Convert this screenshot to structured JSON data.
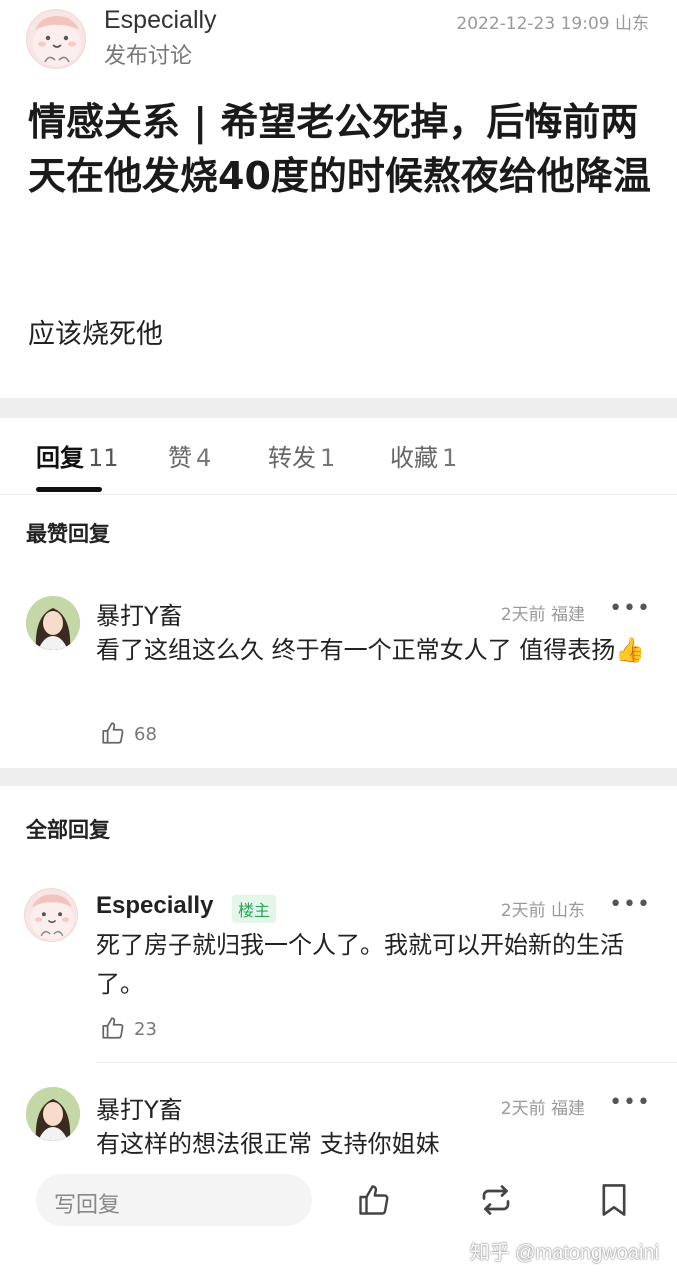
{
  "post": {
    "author": "Especially",
    "action": "发布讨论",
    "time": "2022-12-23 19:09 山东",
    "title": "情感关系 | 希望老公死掉，后悔前两天在他发烧40度的时候熬夜给他降温",
    "body": "应该烧死他"
  },
  "tabs": [
    {
      "label": "回复",
      "count": "11"
    },
    {
      "label": "赞",
      "count": "4"
    },
    {
      "label": "转发",
      "count": "1"
    },
    {
      "label": "收藏",
      "count": "1"
    }
  ],
  "sections": {
    "top_replies": "最赞回复",
    "all_replies": "全部回复"
  },
  "comments": [
    {
      "name": "暴打Y畜",
      "time": "2天前 福建",
      "text": "看了这组这么久 终于有一个正常女人了 值得表扬👍",
      "likes": "68",
      "badge": ""
    },
    {
      "name": "Especially",
      "time": "2天前 山东",
      "text": "死了房子就归我一个人了。我就可以开始新的生活了。",
      "likes": "23",
      "badge": "楼主"
    },
    {
      "name": "暴打Y畜",
      "time": "2天前 福建",
      "text": "有这样的想法很正常 支持你姐妹",
      "likes": "",
      "badge": ""
    }
  ],
  "more_icon": "•••",
  "bottom_bar": {
    "reply_placeholder": "写回复",
    "icons": [
      "like-icon",
      "repost-icon",
      "bookmark-icon"
    ]
  },
  "watermark": "知乎 @matongwoaini",
  "colors": {
    "owner_badge": "#2aa55a",
    "tab_active": "#111111",
    "divider_band": "#eeeeee"
  }
}
